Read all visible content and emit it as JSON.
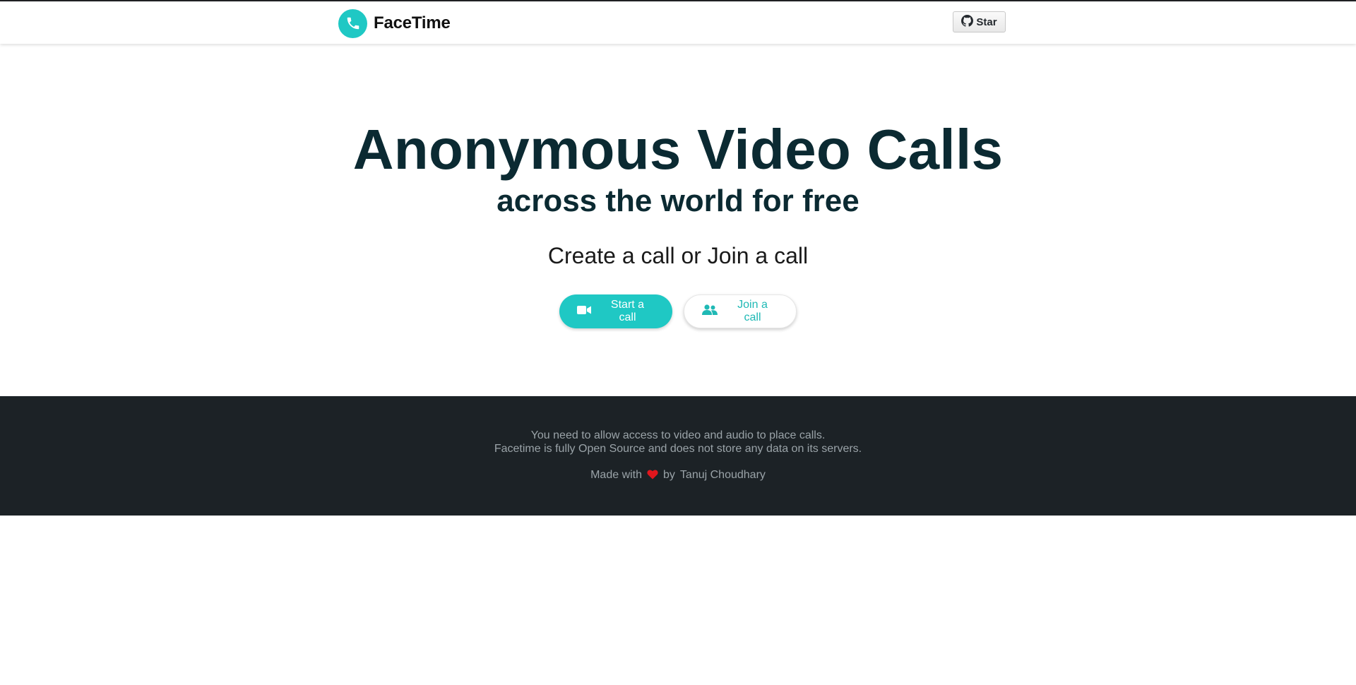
{
  "navbar": {
    "brand": {
      "name": "FaceTime",
      "icon": "phone-icon"
    },
    "github_star": {
      "label": "Star",
      "icon": "github-icon"
    }
  },
  "hero": {
    "title": "Anonymous Video Calls",
    "subtitle": "across the world for free",
    "prompt": "Create a call or Join a call",
    "start_button": {
      "label": "Start a call",
      "icon": "video-camera-icon"
    },
    "join_button": {
      "label": "Join a call",
      "icon": "users-icon"
    }
  },
  "footer": {
    "line1": "You need to allow access to video and audio to place calls.",
    "line2": "Facetime is fully Open Source and does not store any data on its servers.",
    "made_with": "Made with",
    "heart_icon": "heart-icon",
    "by": "by",
    "author": "Tanuj Choudhary"
  },
  "colors": {
    "accent": "#1fc8c4",
    "heading": "#0b2a32",
    "footer_bg": "#1c2226",
    "footer_text": "#9aa3a8",
    "heart": "#e0161d"
  }
}
